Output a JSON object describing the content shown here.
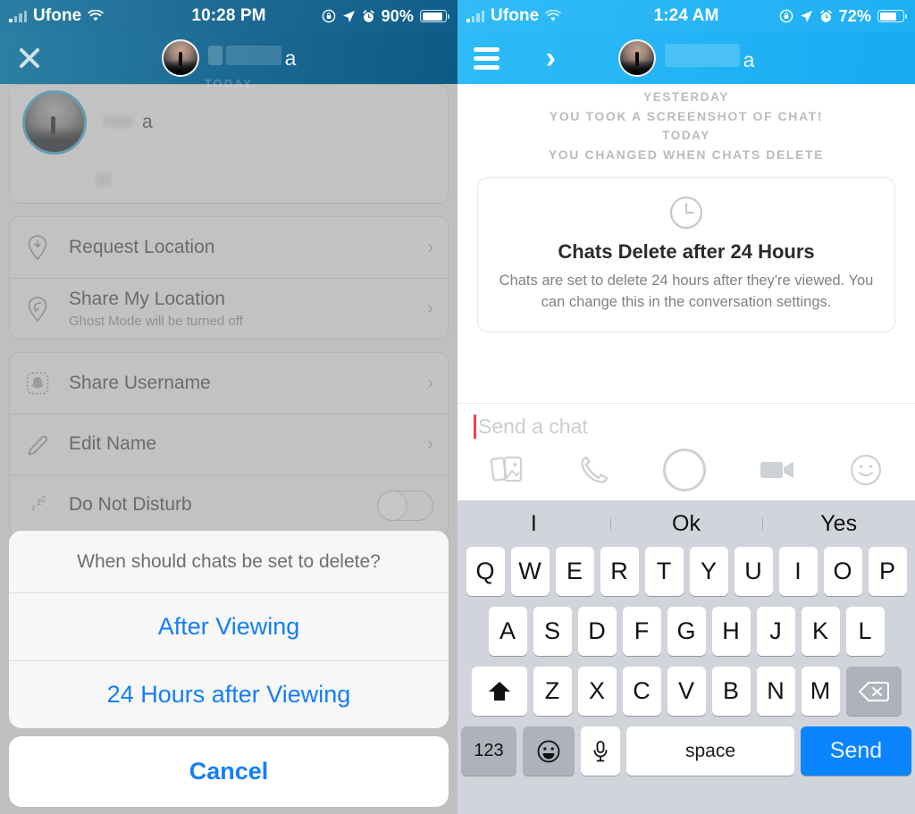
{
  "left": {
    "status": {
      "carrier": "Ufone",
      "time": "10:28 PM",
      "battery_pct": "90%",
      "wifi_icon": "wifi-icon",
      "lock_rotation_icon": "rotation-lock-icon",
      "location_icon": "location-arrow-icon",
      "alarm_icon": "alarm-icon"
    },
    "nav": {
      "close_icon": "close-icon",
      "name_tail": "a",
      "avatar": "friend-avatar"
    },
    "ghost_label": "TODAY",
    "profile": {
      "name_tail": "a"
    },
    "rows": [
      {
        "icon": "request-location-icon",
        "title": "Request Location",
        "sub": "",
        "accessory": "chevron"
      },
      {
        "icon": "share-location-icon",
        "title": "Share My Location",
        "sub": "Ghost Mode will be turned off",
        "accessory": "chevron"
      },
      {
        "icon": "snapcode-icon",
        "title": "Share Username",
        "sub": "",
        "accessory": "chevron"
      },
      {
        "icon": "pencil-icon",
        "title": "Edit Name",
        "sub": "",
        "accessory": "chevron"
      },
      {
        "icon": "sleep-icon",
        "title": "Do Not Disturb",
        "sub": "",
        "accessory": "toggle",
        "toggle_on": false
      }
    ],
    "action_sheet": {
      "title": "When should chats be set to delete?",
      "options": [
        "After Viewing",
        "24 Hours after Viewing"
      ],
      "cancel": "Cancel",
      "accent": "#147efb"
    }
  },
  "right": {
    "status": {
      "carrier": "Ufone",
      "time": "1:24 AM",
      "battery_pct": "72%",
      "wifi_icon": "wifi-icon",
      "lock_rotation_icon": "rotation-lock-icon",
      "location_icon": "location-arrow-icon",
      "alarm_icon": "alarm-icon"
    },
    "nav": {
      "menu_icon": "hamburger-menu-icon",
      "name_tail": "a",
      "forward_icon": "chevron-right-icon",
      "avatar": "friend-avatar"
    },
    "system_lines": [
      "YESTERDAY",
      "YOU TOOK A SCREENSHOT OF CHAT!",
      "TODAY",
      "YOU CHANGED WHEN CHATS DELETE"
    ],
    "notice": {
      "icon": "clock-icon",
      "title": "Chats Delete after 24 Hours",
      "body": "Chats are set to delete 24 hours after they're viewed. You can change this in the conversation settings."
    },
    "composer": {
      "placeholder": "Send a chat",
      "icons": [
        "stickers-icon",
        "phone-icon",
        "camera-capture-icon",
        "video-camera-icon",
        "emoji-face-icon"
      ]
    },
    "keyboard": {
      "predictions": [
        "I",
        "Ok",
        "Yes"
      ],
      "row1": [
        "Q",
        "W",
        "E",
        "R",
        "T",
        "Y",
        "U",
        "I",
        "O",
        "P"
      ],
      "row2": [
        "A",
        "S",
        "D",
        "F",
        "G",
        "H",
        "J",
        "K",
        "L"
      ],
      "row3": [
        "Z",
        "X",
        "C",
        "V",
        "B",
        "N",
        "M"
      ],
      "shift_icon": "shift-arrow-icon",
      "delete_icon": "backspace-icon",
      "numbers_key": "123",
      "emoji_icon": "emoji-keyboard-icon",
      "mic_icon": "microphone-icon",
      "space_key": "space",
      "send_key": "Send",
      "send_color": "#0a84ff"
    }
  }
}
